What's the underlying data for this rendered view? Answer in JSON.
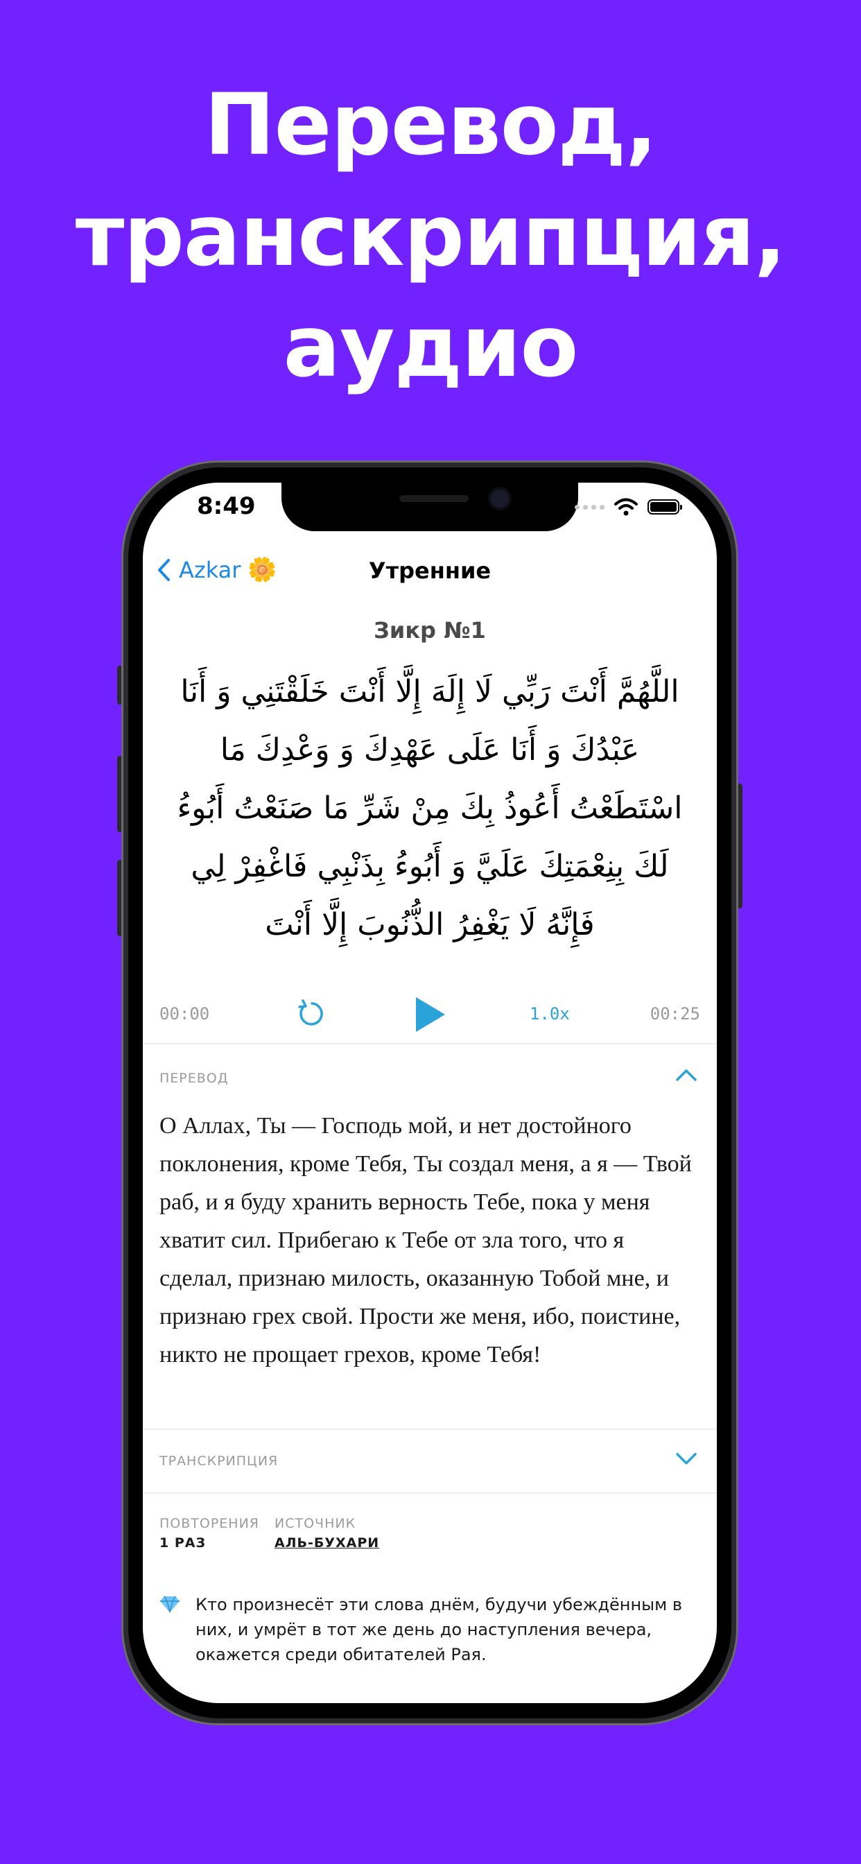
{
  "headline": {
    "line1": "Перевод,",
    "line2": "транскрипция,",
    "line3": "аудио"
  },
  "status_bar": {
    "time": "8:49",
    "icons": [
      "signal-dots-icon",
      "wifi-icon",
      "battery-icon"
    ]
  },
  "navbar": {
    "back_label": "Azkar",
    "back_emoji": "🌼",
    "title": "Утренние"
  },
  "zikr": {
    "title": "Зикр №1",
    "arabic_lines": [
      "اللَّهُمَّ أَنْتَ رَبِّي لَا إِلَهَ إِلَّا أَنْتَ خَلَقْتَنِي وَ أَنَا",
      "عَبْدُكَ وَ أَنَا عَلَى عَهْدِكَ وَ وَعْدِكَ مَا",
      "اسْتَطَعْتُ أَعُوذُ بِكَ مِنْ شَرِّ مَا صَنَعْتُ أَبُوءُ",
      "لَكَ بِنِعْمَتِكَ عَلَيَّ وَ أَبُوءُ بِذَنْبِي فَاغْفِرْ لِي",
      "فَإِنَّهُ لَا يَغْفِرُ الذُّنُوبَ إِلَّا أَنْتَ"
    ]
  },
  "player": {
    "current_time": "00:00",
    "speed": "1.0x",
    "duration": "00:25",
    "accent_color": "#29A3D8"
  },
  "translation": {
    "label": "ПЕРЕВОД",
    "text": "О Аллах, Ты — Господь мой, и нет достойного поклонения, кроме Тебя, Ты создал меня, а я — Твой раб, и я буду хранить верность Тебе, пока у меня хватит сил. Прибегаю к Тебе от зла того, что я сделал, признаю милость, ока­занную Тобой мне, и признаю грех свой. Про­сти же меня, ибо, поистине, никто не проща­ет грехов, кроме Тебя!"
  },
  "transcription": {
    "label": "ТРАНСКРИПЦИЯ"
  },
  "meta": {
    "repeats_label": "ПОВТОРЕНИЯ",
    "repeats_value": "1 РАЗ",
    "source_label": "ИСТОЧНИК",
    "source_value": "АЛЬ-БУХАРИ"
  },
  "note": {
    "icon": "gem-icon",
    "text": "Кто произнесёт эти слова днём, будучи убеждённым в них, и умрёт в тот же день до наступления вечера, окажется среди обитателей Рая."
  },
  "colors": {
    "background": "#7222FF",
    "link": "#1E88E5"
  }
}
